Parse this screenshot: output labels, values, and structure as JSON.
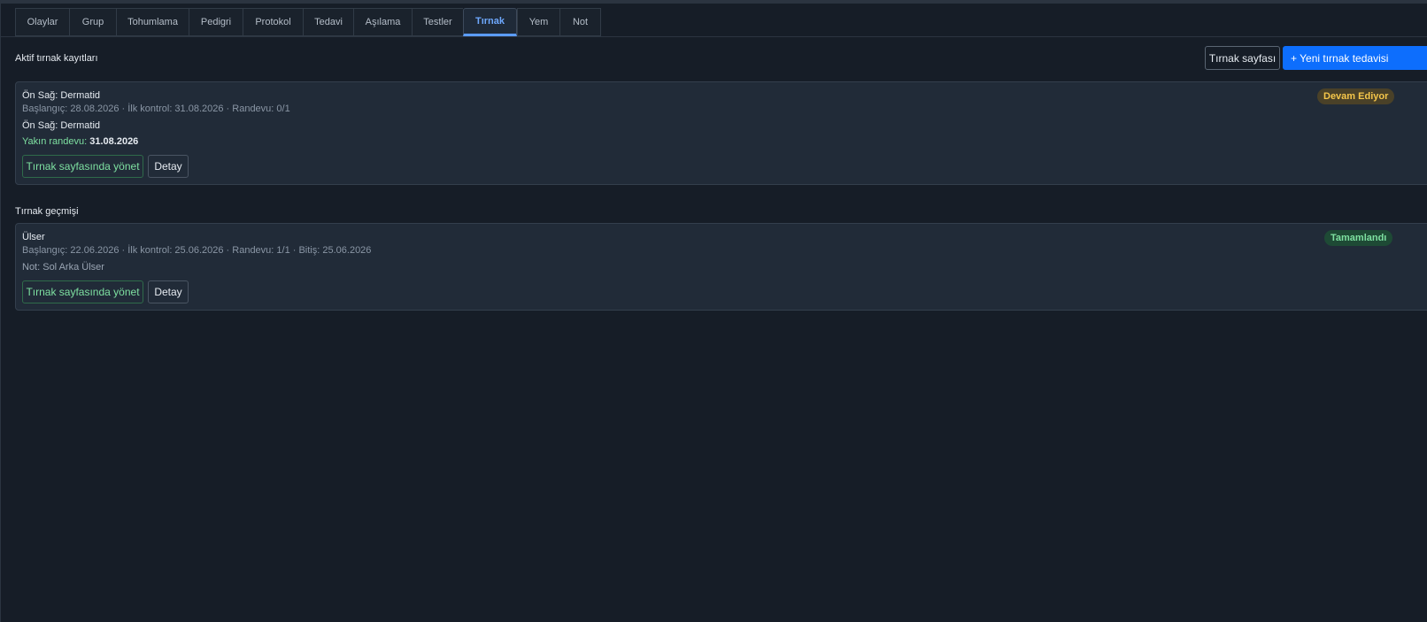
{
  "tabs": [
    {
      "label": "Olaylar"
    },
    {
      "label": "Grup"
    },
    {
      "label": "Tohumlama"
    },
    {
      "label": "Pedigri"
    },
    {
      "label": "Protokol"
    },
    {
      "label": "Tedavi"
    },
    {
      "label": "Aşılama"
    },
    {
      "label": "Testler"
    },
    {
      "label": "Tırnak",
      "active": true
    },
    {
      "label": "Yem"
    },
    {
      "label": "Not"
    }
  ],
  "active_section": {
    "title": "Aktif tırnak kayıtları",
    "page_button": "Tırnak sayfası",
    "new_button": "+ Yeni tırnak tedavisi",
    "records": [
      {
        "title": "Ön Sağ: Dermatid",
        "meta": "Başlangıç: 28.08.2026 · İlk kontrol: 31.08.2026 · Randevu: 0/1",
        "detail": "Ön Sağ: Dermatid",
        "appointment_label": "Yakın randevu:",
        "appointment_date": "31.08.2026",
        "status": "Devam Ediyor",
        "manage_button": "Tırnak sayfasında yönet",
        "detail_button": "Detay"
      }
    ]
  },
  "history_section": {
    "title": "Tırnak geçmişi",
    "records": [
      {
        "title": "Ülser",
        "meta": "Başlangıç: 22.06.2026 · İlk kontrol: 25.06.2026 · Randevu: 1/1 · Bitiş: 25.06.2026",
        "note": "Not: Sol Arka Ülser",
        "status": "Tamamlandı",
        "manage_button": "Tırnak sayfasında yönet",
        "detail_button": "Detay"
      }
    ]
  },
  "colors": {
    "background": "#161d27",
    "card": "#212b38",
    "primary": "#0d6efd",
    "active_tab": "#6ea8fe",
    "success": "#7ee0a1",
    "warning": "#f5c64a"
  }
}
